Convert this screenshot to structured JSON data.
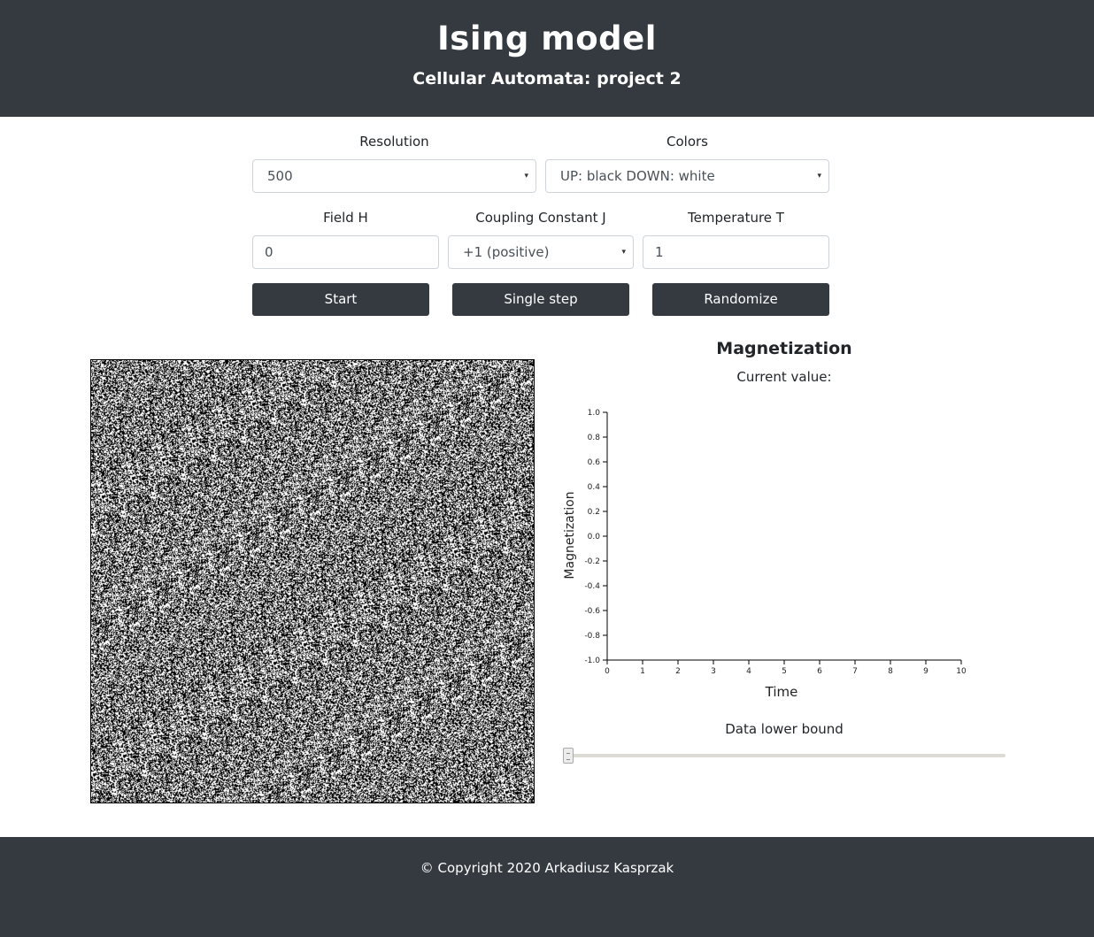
{
  "header": {
    "title": "Ising model",
    "subtitle": "Cellular Automata: project 2"
  },
  "controls": {
    "resolution": {
      "label": "Resolution",
      "value": "500"
    },
    "colors": {
      "label": "Colors",
      "value": "UP: black DOWN: white"
    },
    "field_h": {
      "label": "Field H",
      "value": "0"
    },
    "coupling_j": {
      "label": "Coupling Constant J",
      "value": "+1 (positive)"
    },
    "temperature_t": {
      "label": "Temperature T",
      "value": "1"
    },
    "start_label": "Start",
    "single_step_label": "Single step",
    "randomize_label": "Randomize",
    "caret_icon": "▾"
  },
  "magnetization": {
    "title": "Magnetization",
    "current_value_label": "Current value:"
  },
  "chart_data": {
    "type": "line",
    "xlabel": "Time",
    "ylabel": "Magnetization",
    "xlim": [
      0,
      10
    ],
    "ylim": [
      -1.0,
      1.0
    ],
    "x_ticks": [
      "0",
      "1",
      "2",
      "3",
      "4",
      "5",
      "6",
      "7",
      "8",
      "9",
      "10"
    ],
    "y_ticks": [
      "1.0",
      "0.8",
      "0.6",
      "0.4",
      "0.2",
      "0.0",
      "-0.2",
      "-0.4",
      "-0.6",
      "-0.8",
      "-1.0"
    ],
    "series": [],
    "grid": false
  },
  "slider": {
    "label": "Data lower bound",
    "value": 0
  },
  "footer": {
    "copyright": "© Copyright 2020 Arkadiusz Kasprzak"
  },
  "colors": {
    "dark": "#343a40",
    "spin_up": "#000000",
    "spin_down": "#ffffff"
  }
}
